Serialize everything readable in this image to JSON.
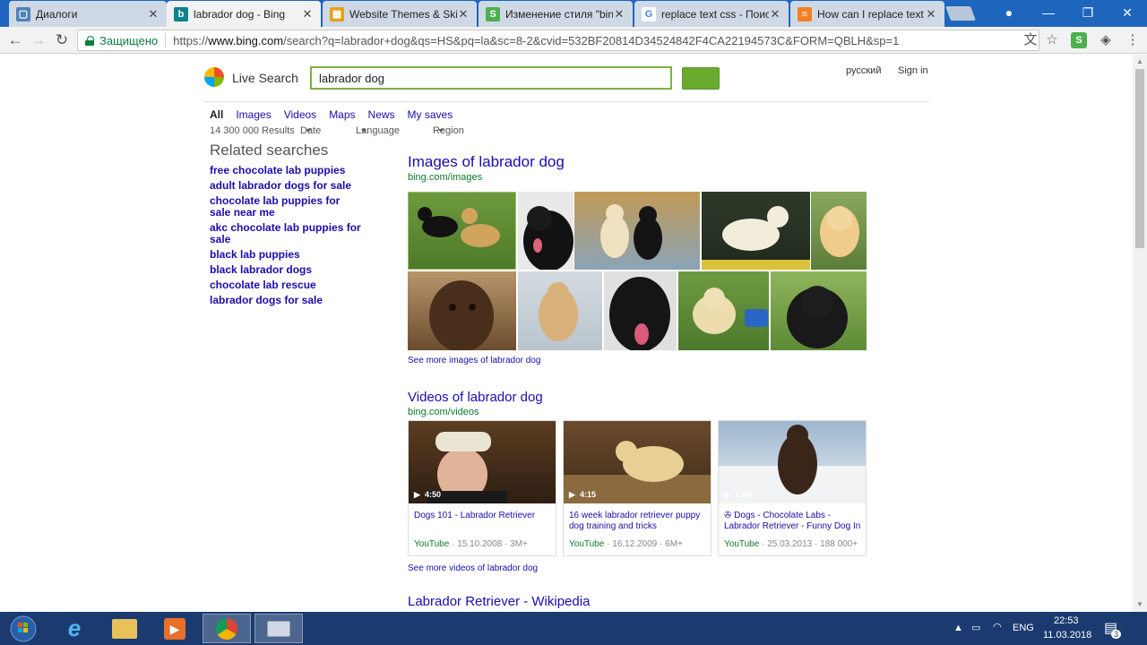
{
  "browser": {
    "tabs": [
      {
        "title": "Диалоги",
        "active": false,
        "favicon_color": "#5181b8"
      },
      {
        "title": "labrador dog - Bing",
        "active": true,
        "favicon_color": "#0f8391"
      },
      {
        "title": "Website Themes & Skins",
        "active": false,
        "favicon_color": "#e5a11b"
      },
      {
        "title": "Изменение стиля \"bing",
        "active": false,
        "favicon_color": "#4caf50"
      },
      {
        "title": "replace text css - Поиск",
        "active": false,
        "favicon_color": "#4285f4"
      },
      {
        "title": "How can I replace text",
        "active": false,
        "favicon_color": "#f48024"
      }
    ],
    "address_secure_label": "Защищено",
    "url_prefix": "https://",
    "url_host": "www.bing.com",
    "url_rest": "/search?q=labrador+dog&qs=HS&pq=la&sc=8-2&cvid=532BF20814D34524842F4CA22194573C&FORM=QBLH&sp=1"
  },
  "header": {
    "logo_text": "Live Search",
    "search_value": "labrador dog",
    "language_link": "русский",
    "signin_link": "Sign in"
  },
  "scopes": [
    "All",
    "Images",
    "Videos",
    "Maps",
    "News",
    "My saves"
  ],
  "filters": {
    "results_count": "14 300 000 Results",
    "date": "Date",
    "language": "Language",
    "region": "Region"
  },
  "related": {
    "title": "Related searches",
    "items": [
      "free chocolate lab puppies",
      "adult labrador dogs for sale",
      "chocolate lab puppies for sale near me",
      "akc chocolate lab puppies for sale",
      "black lab puppies",
      "black labrador dogs",
      "chocolate lab rescue",
      "labrador dogs for sale"
    ]
  },
  "images_section": {
    "title": "Images of labrador dog",
    "url": "bing.com/images",
    "more": "See more images of labrador dog",
    "colors": [
      "#5b8d32",
      "#1d1d1d",
      "#c9a05d",
      "#e9e0c9",
      "#e8c27c",
      "#5a3a24",
      "#d3b07b",
      "#181818",
      "#d8c088",
      "#2a2a2a"
    ]
  },
  "videos_section": {
    "title": "Videos of labrador dog",
    "url": "bing.com/videos",
    "more": "See more videos of labrador dog",
    "videos": [
      {
        "duration": "4:50",
        "title": "Dogs 101 - Labrador Retriever",
        "source": "YouTube",
        "date": "15.10.2008",
        "views": "3M+",
        "thumb_color": "#6a4a2c"
      },
      {
        "duration": "4:15",
        "title": "16 week labrador retriever puppy dog training and tricks",
        "source": "YouTube",
        "date": "16.12.2009",
        "views": "6M+",
        "thumb_color": "#a8844f"
      },
      {
        "duration": "1:09",
        "title": "✇ Dogs - Chocolate Labs - Labrador Retriever - Funny Dog In",
        "source": "YouTube",
        "date": "25.03.2013",
        "views": "188 000+",
        "thumb_color": "#3b2a20"
      }
    ]
  },
  "next_result": {
    "title": "Labrador Retriever - Wikipedia"
  },
  "taskbar": {
    "lang": "ENG",
    "time": "22:53",
    "date": "11.03.2018",
    "notif_count": "3"
  }
}
